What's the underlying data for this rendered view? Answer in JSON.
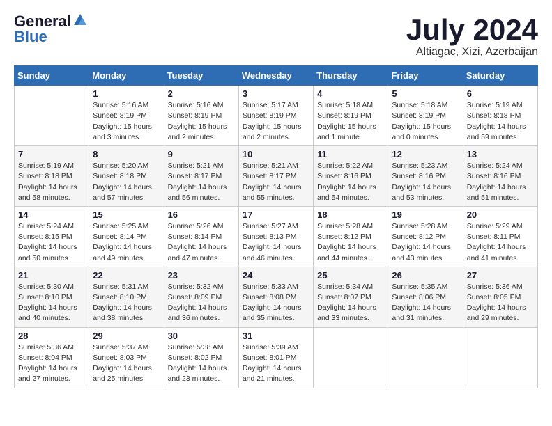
{
  "header": {
    "logo_general": "General",
    "logo_blue": "Blue",
    "month_title": "July 2024",
    "location": "Altiagac, Xizi, Azerbaijan"
  },
  "days_of_week": [
    "Sunday",
    "Monday",
    "Tuesday",
    "Wednesday",
    "Thursday",
    "Friday",
    "Saturday"
  ],
  "weeks": [
    [
      {
        "day": "",
        "info": ""
      },
      {
        "day": "1",
        "info": "Sunrise: 5:16 AM\nSunset: 8:19 PM\nDaylight: 15 hours\nand 3 minutes."
      },
      {
        "day": "2",
        "info": "Sunrise: 5:16 AM\nSunset: 8:19 PM\nDaylight: 15 hours\nand 2 minutes."
      },
      {
        "day": "3",
        "info": "Sunrise: 5:17 AM\nSunset: 8:19 PM\nDaylight: 15 hours\nand 2 minutes."
      },
      {
        "day": "4",
        "info": "Sunrise: 5:18 AM\nSunset: 8:19 PM\nDaylight: 15 hours\nand 1 minute."
      },
      {
        "day": "5",
        "info": "Sunrise: 5:18 AM\nSunset: 8:19 PM\nDaylight: 15 hours\nand 0 minutes."
      },
      {
        "day": "6",
        "info": "Sunrise: 5:19 AM\nSunset: 8:18 PM\nDaylight: 14 hours\nand 59 minutes."
      }
    ],
    [
      {
        "day": "7",
        "info": "Sunrise: 5:19 AM\nSunset: 8:18 PM\nDaylight: 14 hours\nand 58 minutes."
      },
      {
        "day": "8",
        "info": "Sunrise: 5:20 AM\nSunset: 8:18 PM\nDaylight: 14 hours\nand 57 minutes."
      },
      {
        "day": "9",
        "info": "Sunrise: 5:21 AM\nSunset: 8:17 PM\nDaylight: 14 hours\nand 56 minutes."
      },
      {
        "day": "10",
        "info": "Sunrise: 5:21 AM\nSunset: 8:17 PM\nDaylight: 14 hours\nand 55 minutes."
      },
      {
        "day": "11",
        "info": "Sunrise: 5:22 AM\nSunset: 8:16 PM\nDaylight: 14 hours\nand 54 minutes."
      },
      {
        "day": "12",
        "info": "Sunrise: 5:23 AM\nSunset: 8:16 PM\nDaylight: 14 hours\nand 53 minutes."
      },
      {
        "day": "13",
        "info": "Sunrise: 5:24 AM\nSunset: 8:16 PM\nDaylight: 14 hours\nand 51 minutes."
      }
    ],
    [
      {
        "day": "14",
        "info": "Sunrise: 5:24 AM\nSunset: 8:15 PM\nDaylight: 14 hours\nand 50 minutes."
      },
      {
        "day": "15",
        "info": "Sunrise: 5:25 AM\nSunset: 8:14 PM\nDaylight: 14 hours\nand 49 minutes."
      },
      {
        "day": "16",
        "info": "Sunrise: 5:26 AM\nSunset: 8:14 PM\nDaylight: 14 hours\nand 47 minutes."
      },
      {
        "day": "17",
        "info": "Sunrise: 5:27 AM\nSunset: 8:13 PM\nDaylight: 14 hours\nand 46 minutes."
      },
      {
        "day": "18",
        "info": "Sunrise: 5:28 AM\nSunset: 8:12 PM\nDaylight: 14 hours\nand 44 minutes."
      },
      {
        "day": "19",
        "info": "Sunrise: 5:28 AM\nSunset: 8:12 PM\nDaylight: 14 hours\nand 43 minutes."
      },
      {
        "day": "20",
        "info": "Sunrise: 5:29 AM\nSunset: 8:11 PM\nDaylight: 14 hours\nand 41 minutes."
      }
    ],
    [
      {
        "day": "21",
        "info": "Sunrise: 5:30 AM\nSunset: 8:10 PM\nDaylight: 14 hours\nand 40 minutes."
      },
      {
        "day": "22",
        "info": "Sunrise: 5:31 AM\nSunset: 8:10 PM\nDaylight: 14 hours\nand 38 minutes."
      },
      {
        "day": "23",
        "info": "Sunrise: 5:32 AM\nSunset: 8:09 PM\nDaylight: 14 hours\nand 36 minutes."
      },
      {
        "day": "24",
        "info": "Sunrise: 5:33 AM\nSunset: 8:08 PM\nDaylight: 14 hours\nand 35 minutes."
      },
      {
        "day": "25",
        "info": "Sunrise: 5:34 AM\nSunset: 8:07 PM\nDaylight: 14 hours\nand 33 minutes."
      },
      {
        "day": "26",
        "info": "Sunrise: 5:35 AM\nSunset: 8:06 PM\nDaylight: 14 hours\nand 31 minutes."
      },
      {
        "day": "27",
        "info": "Sunrise: 5:36 AM\nSunset: 8:05 PM\nDaylight: 14 hours\nand 29 minutes."
      }
    ],
    [
      {
        "day": "28",
        "info": "Sunrise: 5:36 AM\nSunset: 8:04 PM\nDaylight: 14 hours\nand 27 minutes."
      },
      {
        "day": "29",
        "info": "Sunrise: 5:37 AM\nSunset: 8:03 PM\nDaylight: 14 hours\nand 25 minutes."
      },
      {
        "day": "30",
        "info": "Sunrise: 5:38 AM\nSunset: 8:02 PM\nDaylight: 14 hours\nand 23 minutes."
      },
      {
        "day": "31",
        "info": "Sunrise: 5:39 AM\nSunset: 8:01 PM\nDaylight: 14 hours\nand 21 minutes."
      },
      {
        "day": "",
        "info": ""
      },
      {
        "day": "",
        "info": ""
      },
      {
        "day": "",
        "info": ""
      }
    ]
  ]
}
